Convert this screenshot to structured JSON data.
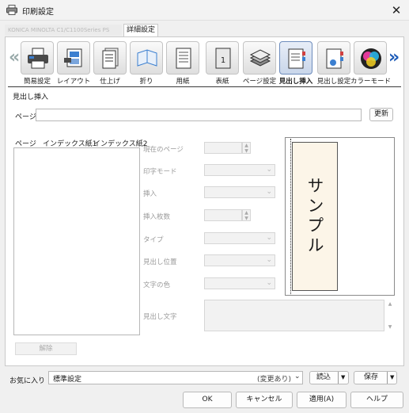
{
  "window": {
    "title": "印刷設定",
    "close_glyph": "✕"
  },
  "tabs": {
    "printer_tab_label": "KONICA MINOLTA C1/C1100Series PS",
    "active_label": "詳細設定"
  },
  "categories": {
    "items": [
      {
        "label": "簡易設定",
        "icon": "printer-icon"
      },
      {
        "label": "レイアウト",
        "icon": "layout-icon"
      },
      {
        "label": "仕上げ",
        "icon": "finishing-icon"
      },
      {
        "label": "折り",
        "icon": "fold-icon"
      },
      {
        "label": "用紙",
        "icon": "paper-icon"
      },
      {
        "label": "表紙",
        "icon": "cover-icon"
      },
      {
        "label": "ページ設定",
        "icon": "page-setup-icon"
      },
      {
        "label": "見出し挿入",
        "icon": "tab-insert-icon",
        "selected": true
      },
      {
        "label": "見出し設定",
        "icon": "tab-settings-icon"
      },
      {
        "label": "カラーモード",
        "icon": "color-mode-icon"
      }
    ],
    "prev_glyph": "«",
    "next_glyph": "»"
  },
  "section": {
    "title": "見出し挿入"
  },
  "page_field": {
    "label": "ページ",
    "value": "",
    "update_button": "更新"
  },
  "list": {
    "headers": [
      "ページ",
      "インデックス紙1",
      "インデックス紙2"
    ],
    "rows": [],
    "delete_button": "解除"
  },
  "settings": {
    "current_page": "現在のページ",
    "print_mode": "印字モード",
    "insert": "挿入",
    "insert_count": "挿入枚数",
    "type": "タイプ",
    "tab_position": "見出し位置",
    "text_color": "文字の色",
    "tab_text": "見出し文字"
  },
  "preview": {
    "sample_text": "サンプル"
  },
  "favorites": {
    "label": "お気に入り",
    "value": "標準設定",
    "changed_note": "(変更あり)",
    "load_button": "読込",
    "save_button": "保存"
  },
  "footer": {
    "ok": "OK",
    "cancel": "キャンセル",
    "apply": "適用(A)",
    "help": "ヘルプ"
  },
  "colors": {
    "accent": "#1c5bb8",
    "selected_tile": "#c9d6ea"
  }
}
